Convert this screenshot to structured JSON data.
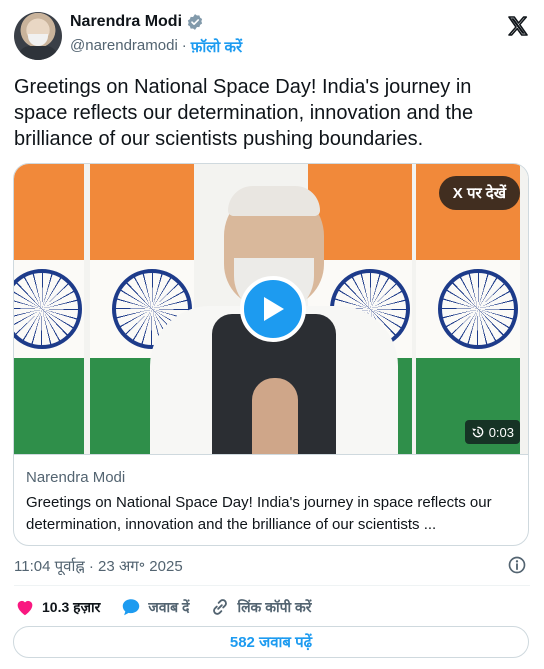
{
  "author": {
    "name": "Narendra Modi",
    "handle": "@narendramodi",
    "separator": "·",
    "follow_label": "फ़ॉलो करें"
  },
  "tweet": {
    "text": "Greetings on National Space Day! India's journey in space reflects our determination, innovation and the brilliance of our scientists pushing boundaries."
  },
  "media": {
    "watch_on_x_label": "X पर देखें",
    "duration": "0:03"
  },
  "card": {
    "author": "Narendra Modi",
    "description": "Greetings on National Space Day! India's journey in space reflects our determination, innovation and the brilliance of our scientists ..."
  },
  "meta": {
    "timestamp": "11:04 पूर्वाह्न · 23 अग॰ 2025"
  },
  "actions": {
    "likes": "10.3 हज़ार",
    "reply_label": "जवाब दें",
    "copy_link_label": "लिंक कॉपी करें"
  },
  "replies_button": "582 जवाब पढ़ें",
  "colors": {
    "accent": "#1d9bf0",
    "like": "#f91880",
    "text": "#0f1419",
    "muted": "#536471"
  },
  "icons": [
    "verified-badge-icon",
    "x-logo-icon",
    "play-icon",
    "replay-icon",
    "info-icon",
    "heart-icon",
    "reply-bubble-icon",
    "link-icon"
  ]
}
